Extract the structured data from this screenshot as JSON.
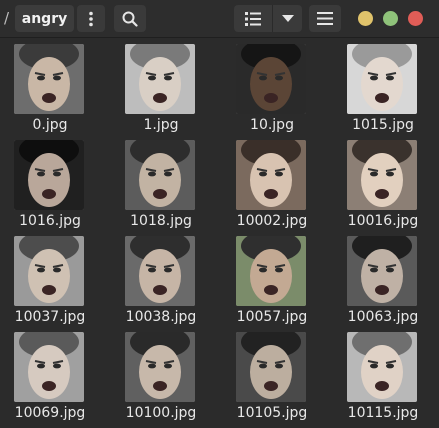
{
  "header": {
    "path_separator": "/",
    "current_folder": "angry"
  },
  "icons": {
    "more": "vertical-dots-icon",
    "search": "search-icon",
    "view": "list-view-icon",
    "view_dropdown": "chevron-down-icon",
    "menu": "hamburger-menu-icon"
  },
  "colors": {
    "minimize": "#e0c36b",
    "maximize": "#8fc27a",
    "close": "#e05d57"
  },
  "files": [
    {
      "name": "0.jpg"
    },
    {
      "name": "1.jpg"
    },
    {
      "name": "10.jpg"
    },
    {
      "name": "1015.jpg"
    },
    {
      "name": "1016.jpg"
    },
    {
      "name": "1018.jpg"
    },
    {
      "name": "10002.jpg"
    },
    {
      "name": "10016.jpg"
    },
    {
      "name": "10037.jpg"
    },
    {
      "name": "10038.jpg"
    },
    {
      "name": "10057.jpg"
    },
    {
      "name": "10063.jpg"
    },
    {
      "name": "10069.jpg"
    },
    {
      "name": "10100.jpg"
    },
    {
      "name": "10105.jpg"
    },
    {
      "name": "10115.jpg"
    }
  ]
}
